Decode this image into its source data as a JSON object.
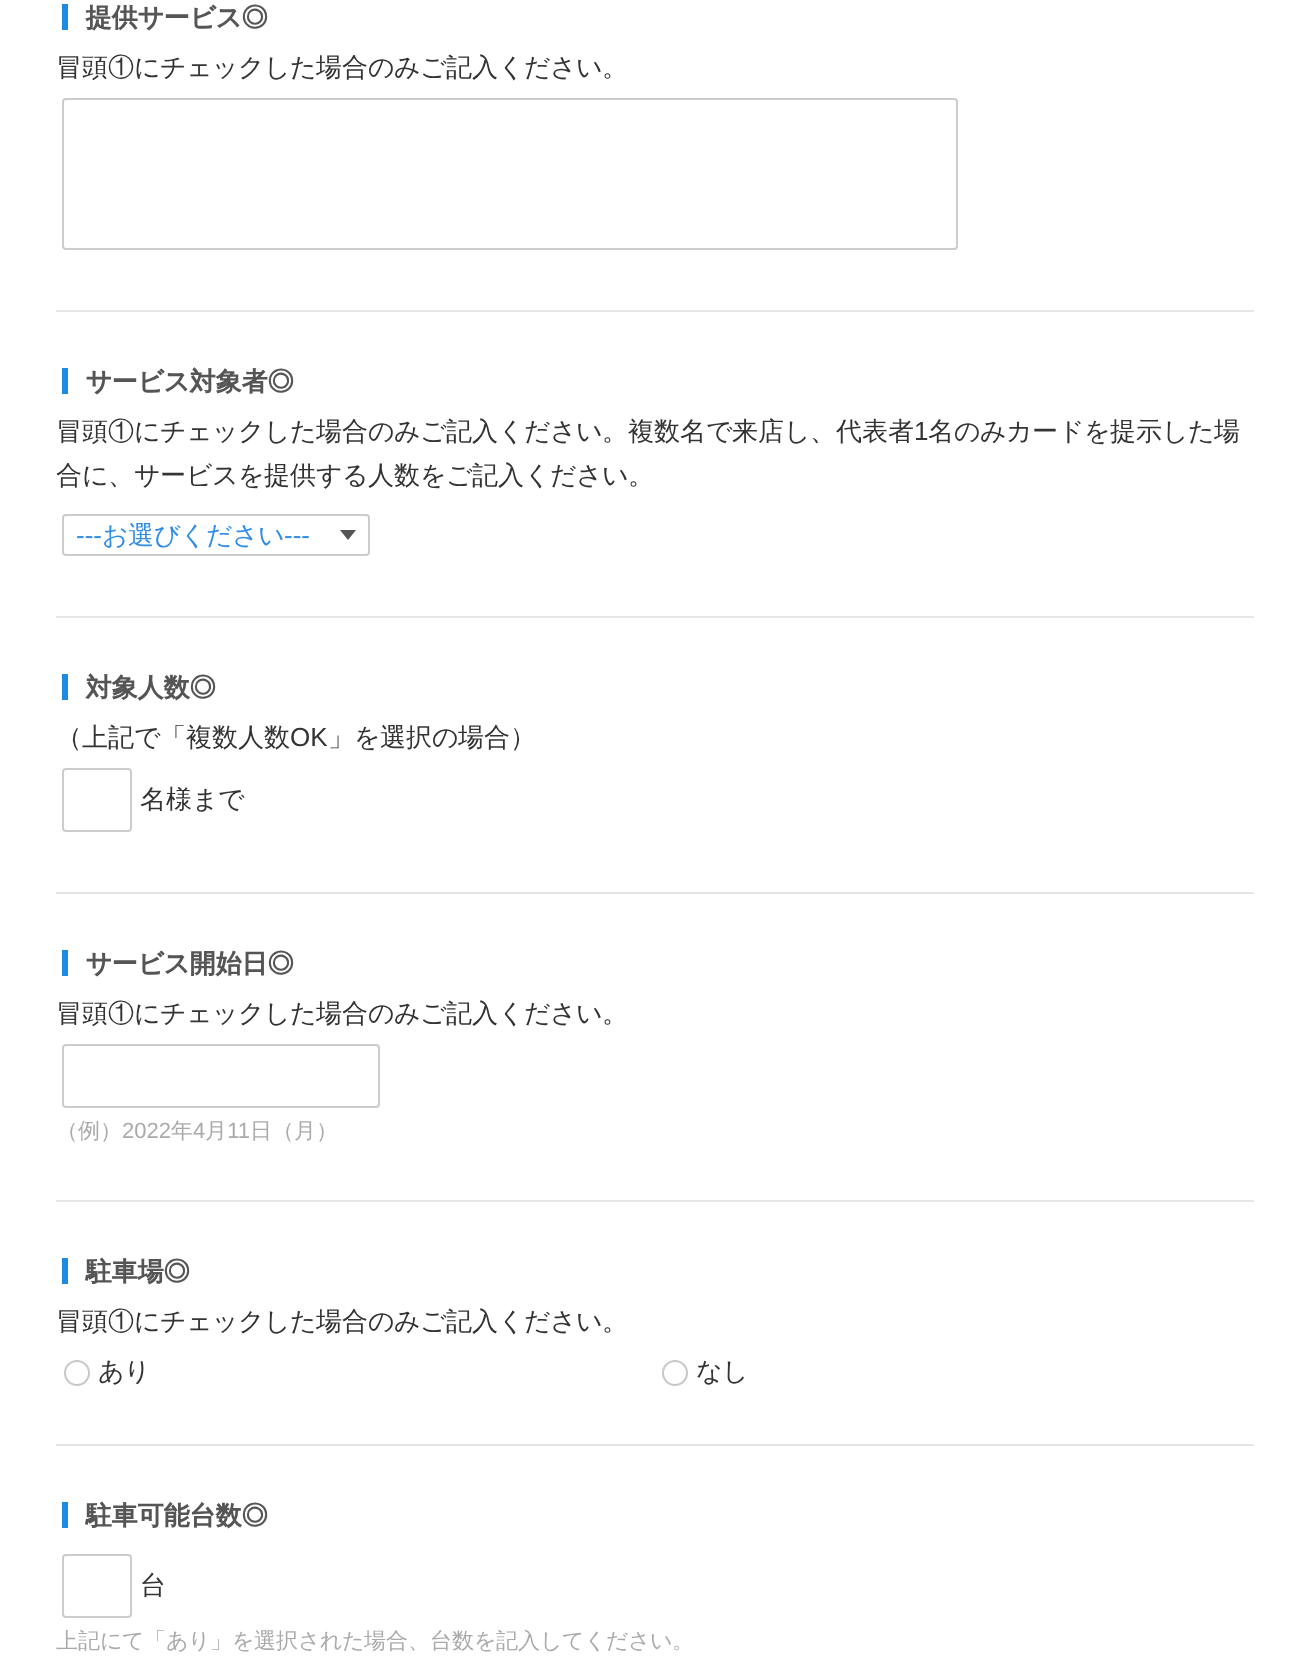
{
  "sections": [
    {
      "kind": "textarea",
      "title": "提供サービス◎",
      "note": "冒頭①にチェックした場合のみご記入ください。"
    },
    {
      "kind": "select",
      "title": "サービス対象者◎",
      "note": "冒頭①にチェックした場合のみご記入ください。複数名で来店し、代表者1名のみカードを提示した場合に、サービスを提供する人数をご記入ください。",
      "select": {
        "value": "---お選びください---"
      }
    },
    {
      "kind": "number",
      "title": "対象人数◎",
      "note": "（上記で「複数人数OK」を選択の場合）",
      "unit": "名様まで"
    },
    {
      "kind": "date",
      "title": "サービス開始日◎",
      "note": "冒頭①にチェックした場合のみご記入ください。",
      "hint": "（例）2022年4月11日（月）"
    },
    {
      "kind": "radio",
      "title": "駐車場◎",
      "note": "冒頭①にチェックした場合のみご記入ください。",
      "options": [
        {
          "label": "あり",
          "selected": false
        },
        {
          "label": "なし",
          "selected": false
        }
      ]
    },
    {
      "kind": "number",
      "title": "駐車可能台数◎",
      "unit": "台",
      "hint": "上記にて「あり」を選択された場合、台数を記入してください。"
    }
  ]
}
